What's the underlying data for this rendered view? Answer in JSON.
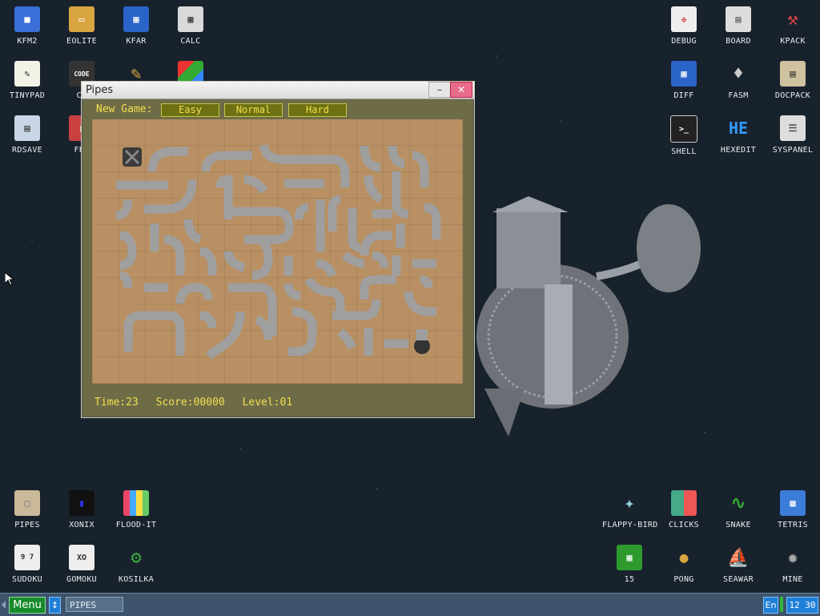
{
  "desktop": {
    "icons_left": [
      {
        "label": "KFM2",
        "color": "#3a6fd8",
        "glyph": "floppy-icon"
      },
      {
        "label": "EOLITE",
        "color": "#d9a541",
        "glyph": "folder-icon"
      },
      {
        "label": "KFAR",
        "color": "#2b64c9",
        "glyph": "kfar-icon"
      },
      {
        "label": "CALC",
        "color": "#d9d9d9",
        "glyph": "calculator-icon"
      },
      {
        "label": "TINYPAD",
        "color": "#f2f2e6",
        "glyph": "notepad-icon"
      },
      {
        "label": "CE",
        "color": "#333",
        "glyph": "code-icon"
      },
      {
        "label": "RDSAVE",
        "color": "#c9d6e6",
        "glyph": "rdsave-icon"
      },
      {
        "label": "FB2",
        "color": "#c84040",
        "glyph": "book-icon"
      }
    ],
    "icons_right": [
      {
        "label": "DEBUG",
        "color": "#eeeeee",
        "glyph": "debug-icon"
      },
      {
        "label": "BOARD",
        "color": "#dddddd",
        "glyph": "board-icon"
      },
      {
        "label": "KPACK",
        "color": "#c44",
        "glyph": "wrench-icon"
      },
      {
        "label": "DIFF",
        "color": "#2b64c9",
        "glyph": "diff-icon"
      },
      {
        "label": "FASM",
        "color": "#bbbbbb",
        "glyph": "fasm-icon"
      },
      {
        "label": "DOCPACK",
        "color": "#cfc2a0",
        "glyph": "cabinet-icon"
      },
      {
        "label": "SHELL",
        "color": "#222222",
        "glyph": "terminal-icon"
      },
      {
        "label": "HEXEDIT",
        "color": "#18222c",
        "glyph": "hex-icon"
      },
      {
        "label": "SYSPANEL",
        "color": "#dddddd",
        "glyph": "sliders-icon"
      }
    ],
    "icons_bottom_left": [
      {
        "label": "PIPES",
        "color": "#9aa3b0",
        "glyph": "pipes-icon"
      },
      {
        "label": "XONIX",
        "color": "#222",
        "glyph": "xonix-icon"
      },
      {
        "label": "FLOOD-IT",
        "color": "#e46",
        "glyph": "flood-icon"
      },
      {
        "label": "SUDOKU",
        "color": "#eeeeee",
        "glyph": "sudoku-icon"
      },
      {
        "label": "GOMOKU",
        "color": "#eeeeee",
        "glyph": "gomoku-icon"
      },
      {
        "label": "KOSILKA",
        "color": "#3cb043",
        "glyph": "mower-icon"
      }
    ],
    "icons_bottom_right": [
      {
        "label": "FLAPPY-BIRD",
        "color": "#8fd0d8",
        "glyph": "bird-icon"
      },
      {
        "label": "CLICKS",
        "color": "#4a8",
        "glyph": "clicks-icon"
      },
      {
        "label": "SNAKE",
        "color": "#3a3",
        "glyph": "snake-icon"
      },
      {
        "label": "TETRIS",
        "color": "#3b7dd8",
        "glyph": "tetris-icon"
      },
      {
        "label": "15",
        "color": "#2e9a2e",
        "glyph": "fifteen-icon"
      },
      {
        "label": "PONG",
        "color": "#d9a541",
        "glyph": "pong-icon"
      },
      {
        "label": "SEAWAR",
        "color": "#a87",
        "glyph": "ship-icon"
      },
      {
        "label": "MINE",
        "color": "#888",
        "glyph": "mine-icon"
      }
    ]
  },
  "window": {
    "title": "Pipes",
    "new_game_label": "New Game:",
    "buttons": [
      "Easy",
      "Normal",
      "Hard"
    ],
    "status": {
      "time": "Time:23",
      "score": "Score:00000",
      "level": "Level:01"
    }
  },
  "taskbar": {
    "menu_label": "Menu",
    "switch_glyph": "↕",
    "task_label": "PIPES",
    "lang": "En",
    "clock": "12 30"
  },
  "colors": {
    "pipe": "#a8a8a8",
    "board": "#b89063",
    "accent_text": "#f3df4f"
  }
}
